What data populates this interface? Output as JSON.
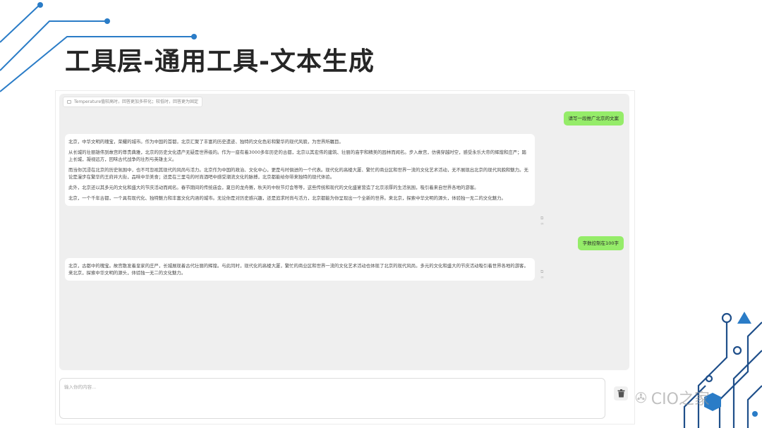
{
  "slide": {
    "title": "工具层-通用工具-文本生成"
  },
  "chat": {
    "hint": "Temperature值较高时，回答更加多样化；较低时，回答更为固定",
    "messages": [
      {
        "role": "user",
        "text": "请写一段推广北京的文案"
      },
      {
        "role": "assistant",
        "paragraphs": [
          "北京，中华文明的瑰宝，荣耀的城市。作为中国的首都，北京汇聚了丰富的历史遗迹、独特的文化色彩和繁华的现代风貌，为世界所瞩目。",
          "从长城的壮丽雄伟到故宫的尊贵典雅，北京的历史文化遗产无疑是世界级的。作为一座有着3000多年历史的古都，北京以其宏伟的建筑、壮丽的庙宇和精美的园林而闻名。步入故宫，仿佛穿越时空，感受永乐大帝的辉煌和庄严；踏上长城，凝视远方，回味古代战争的壮烈与英雄主义。",
          "而当你沉浸在北京的历史氛围中，也不可忽视其现代的风尚与活力。北京作为中国的政治、文化中心，更是与时俱进的一个代表。现代化的高楼大厦、繁忙的商业区和世界一流的文化艺术活动，无不展现出北京的现代风貌和魅力。无论是漫步在繁华的王府井大街，品味中华美食；还是在三里屯的时尚酒吧中感受潮流文化的脉搏，北京都能给你带来独特的现代体验。",
          "此外，北京还以其多元的文化和盛大的节庆活动而闻名。春节期间的传统庙会，夏日的龙舟赛，秋天的中秋节灯会等等，这些传统和现代的文化盛宴营造了北京浓厚的生活氛围，吸引着来自世界各地的游客。",
          "北京，一个千年古都，一个具有现代化、独特魅力和丰富文化内涵的城市。无论你是对历史感兴趣，还是追求时尚与活力，北京都能为你呈现出一个全新的世界。来北京，探索中华文明的源头，体验独一无二的文化魅力。"
        ]
      },
      {
        "role": "user",
        "text": "字数控制在100字"
      },
      {
        "role": "assistant",
        "paragraphs": [
          "北京，古都中的瑰宝。故宫散发着皇家的庄严，长城展现着古代壮丽的辉煌。与此同时，现代化的高楼大厦，繁忙的商业区和世界一流的文化艺术活动也体现了北京的现代风尚。多元的文化和盛大的节庆活动吸引着世界各地的游客。来北京，探索中华文明的源头，体验独一无二的文化魅力。"
        ]
      }
    ]
  },
  "input": {
    "placeholder": "输入你的内容..."
  },
  "watermark": {
    "text": "CIO之家"
  },
  "colors": {
    "user_bubble": "#95ec69",
    "panel_bg": "#efefef",
    "accent_blue": "#1b5fa8"
  }
}
